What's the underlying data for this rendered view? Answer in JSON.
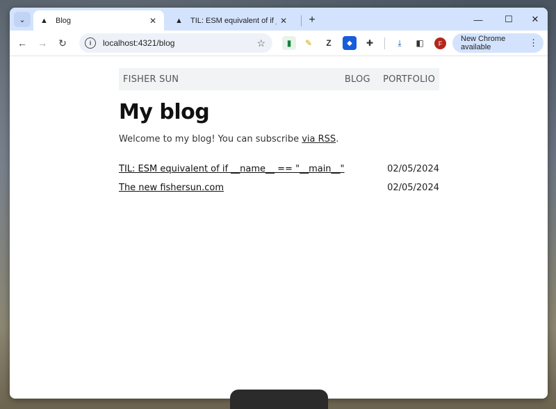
{
  "browser": {
    "tabs": [
      {
        "title": "Blog",
        "active": true
      },
      {
        "title": "TIL: ESM equivalent of if __name",
        "active": false
      }
    ],
    "address": "localhost:4321/blog",
    "update_label": "New Chrome available",
    "profile_initial": "F"
  },
  "site": {
    "brand": "FISHER SUN",
    "nav": [
      "BLOG",
      "PORTFOLIO"
    ],
    "heading": "My blog",
    "intro_text": "Welcome to my blog! You can subscribe ",
    "intro_link": "via RSS",
    "intro_end": ".",
    "posts": [
      {
        "title": "TIL: ESM equivalent of if __name__ == \"__main__\"",
        "date": "02/05/2024"
      },
      {
        "title": "The new fishersun.com",
        "date": "02/05/2024"
      }
    ]
  },
  "colors": {
    "tabstrip": "#d3e3fd",
    "profile": "#b3261e"
  }
}
